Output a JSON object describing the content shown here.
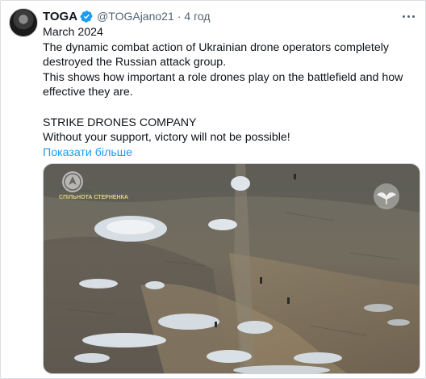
{
  "tweet": {
    "author_name": "TOGA",
    "handle": "@TOGAjano21",
    "separator": "·",
    "time": "4 год",
    "lines": [
      "March 2024",
      "The dynamic combat action of Ukrainian drone operators completely",
      "destroyed the Russian attack group.",
      "This shows how important a role drones play on the battlefield and how",
      "effective they are."
    ],
    "lines_2": [
      "STRIKE DRONES COMPANY",
      "Without your support, victory will not be possible!"
    ],
    "show_more": "Показати більше"
  },
  "media": {
    "watermark": "СПІЛЬНОТА СТЕРНЕНКА"
  },
  "icons": {
    "verified": "verified-badge-icon",
    "more": "more-options-icon",
    "watermark_left": "drone-emblem-icon",
    "watermark_right": "wings-emblem-icon"
  },
  "colors": {
    "link": "#1d9bf0",
    "verified": "#1d9bf0",
    "secondary_text": "#536471"
  }
}
